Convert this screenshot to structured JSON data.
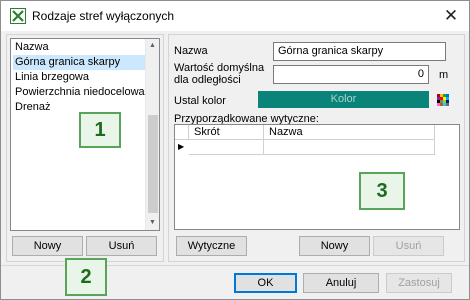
{
  "window": {
    "title": "Rodzaje stref wyłączonych",
    "icon": "excel-like-app-icon",
    "close_label": "✕"
  },
  "zones": {
    "header": "Nazwa",
    "items": [
      {
        "label": "Górna granica skarpy",
        "selected": true
      },
      {
        "label": "Linia brzegowa",
        "selected": false
      },
      {
        "label": "Powierzchnia niedocelowa",
        "selected": false
      },
      {
        "label": "Drenaż",
        "selected": false
      }
    ],
    "new_label": "Nowy",
    "delete_label": "Usuń"
  },
  "details": {
    "name_label": "Nazwa",
    "name_value": "Górna granica skarpy",
    "distance_label_line1": "Wartość domyślna",
    "distance_label_line2": "dla odległości",
    "distance_value": "0",
    "distance_unit": "m",
    "color_label": "Ustal kolor",
    "color_button_label": "Kolor",
    "color_value": "#0a8478",
    "guidelines_label": "Przyporządkowane wytyczne:",
    "columns": [
      "Skrót",
      "Nazwa"
    ],
    "row_marker": "▶",
    "guidelines_button": "Wytyczne",
    "new_label": "Nowy",
    "delete_label": "Usuń"
  },
  "footer": {
    "ok_label": "OK",
    "cancel_label": "Anuluj",
    "apply_label": "Zastosuj"
  },
  "badges": {
    "one": "1",
    "two": "2",
    "three": "3"
  }
}
